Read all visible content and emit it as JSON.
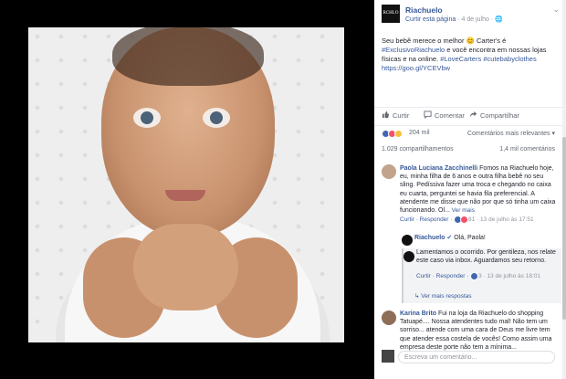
{
  "page": {
    "name": "Riachuelo",
    "logo_text": "RCHLO",
    "curtir_link": "Curtir esta página",
    "date": "4 de julho"
  },
  "post": {
    "text_intro": "Seu bebê merece o melhor 😊 Carter's é",
    "text_tags": "#ExclusivoRiachuelo",
    "text_mid": " e você encontra em nossas lojas físicas e na online.",
    "text_tag2": " #LoveCarters",
    "text_tag3": "#cutebabyclothes",
    "text_url": " https://goo.gl/YCEVbw"
  },
  "actions": {
    "like": "Curtir",
    "comment": "Comentar",
    "share": "Compartilhar"
  },
  "reactions": {
    "count": "204 mil",
    "sort_label": "Comentários mais relevantes ▾"
  },
  "stats": {
    "shares": "1.029 compartilhamentos",
    "comments": "1,4 mil comentários"
  },
  "comments": [
    {
      "author": "Paola Luciana Zacchinelli",
      "text": " Fomos na Riachuelo hoje, eu, minha filha de 6 anos e outra filha bebê no seu sling. Pedíssiva fazer uma troca e chegando no caixa eu cuarta, perguntei se havia fila preferencial. A atendente me disse que não por que só tinha um caixa funcionando. Ol...",
      "more": " Ver mais",
      "meta_actions": "Curtir · Responder · ",
      "meta_count": " 81 · 13 de julho às 17:51"
    }
  ],
  "reply": {
    "author": "Riachuelo",
    "greeting": " Olá, Paola!",
    "text": "Lamentamos o ocorrido. Por gentileza, nos relate este caso via inbox. Aguardamos seu retorno.",
    "meta_actions": "Curtir · Responder · ",
    "meta_count": " 3 · 13 de julho às 18:01",
    "more_replies": "↳ Ver mais respostas"
  },
  "comment2": {
    "author": "Karina Brito",
    "text": " Fui na loja da Riachuelo do shopping Tatuapé.... Nossa atendentes tudo mal! Não tem um sorriso... atende com uma cara de Deus me livre tem que atender essa costela de vocês! Como assim uma empresa deste porte não tem a mínima..."
  },
  "write": {
    "placeholder": "Escreva um comentário..."
  }
}
